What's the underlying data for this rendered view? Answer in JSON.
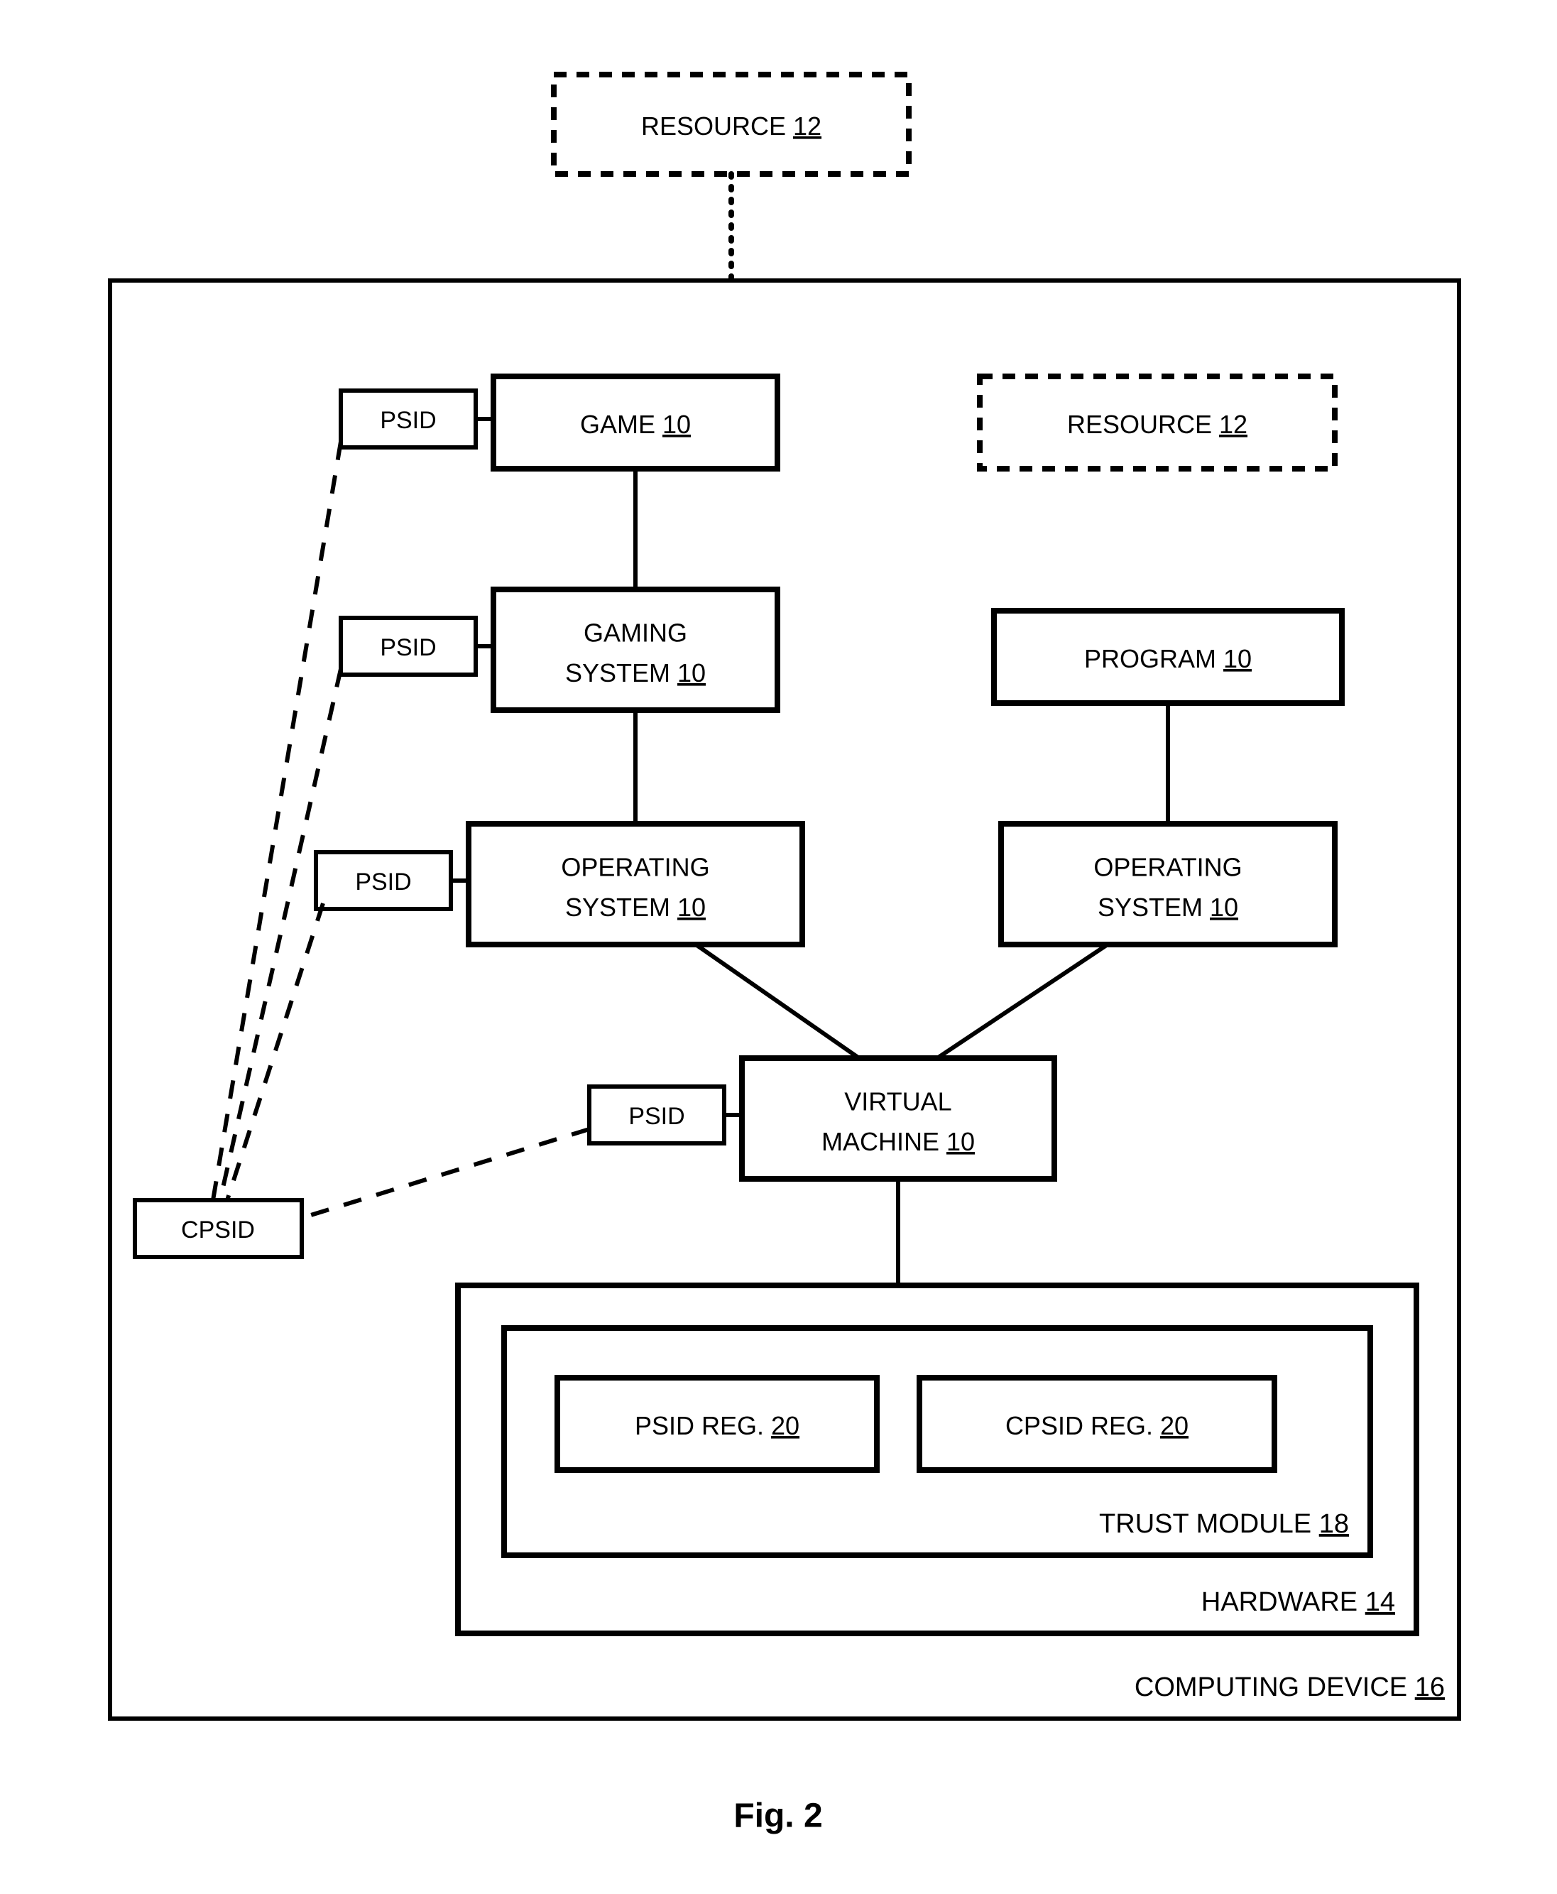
{
  "figure_label": "Fig. 2",
  "resource_ext": {
    "label": "RESOURCE",
    "num": "12"
  },
  "resource_int": {
    "label": "RESOURCE",
    "num": "12"
  },
  "game": {
    "label": "GAME",
    "num": "10",
    "psid": "PSID"
  },
  "gaming_sys": {
    "line1": "GAMING",
    "line2": "SYSTEM",
    "num": "10",
    "psid": "PSID"
  },
  "os_left": {
    "line1": "OPERATING",
    "line2": "SYSTEM",
    "num": "10",
    "psid": "PSID"
  },
  "program": {
    "label": "PROGRAM",
    "num": "10"
  },
  "os_right": {
    "line1": "OPERATING",
    "line2": "SYSTEM",
    "num": "10"
  },
  "vm": {
    "line1": "VIRTUAL",
    "line2": "MACHINE",
    "num": "10",
    "psid": "PSID"
  },
  "cpsid": {
    "label": "CPSID"
  },
  "hardware": {
    "label": "HARDWARE",
    "num": "14"
  },
  "trust": {
    "label": "TRUST MODULE",
    "num": "18"
  },
  "psid_reg": {
    "label": "PSID REG.",
    "num": "20"
  },
  "cpsid_reg": {
    "label": "CPSID REG.",
    "num": "20"
  },
  "computing": {
    "label": "COMPUTING DEVICE",
    "num": "16"
  }
}
